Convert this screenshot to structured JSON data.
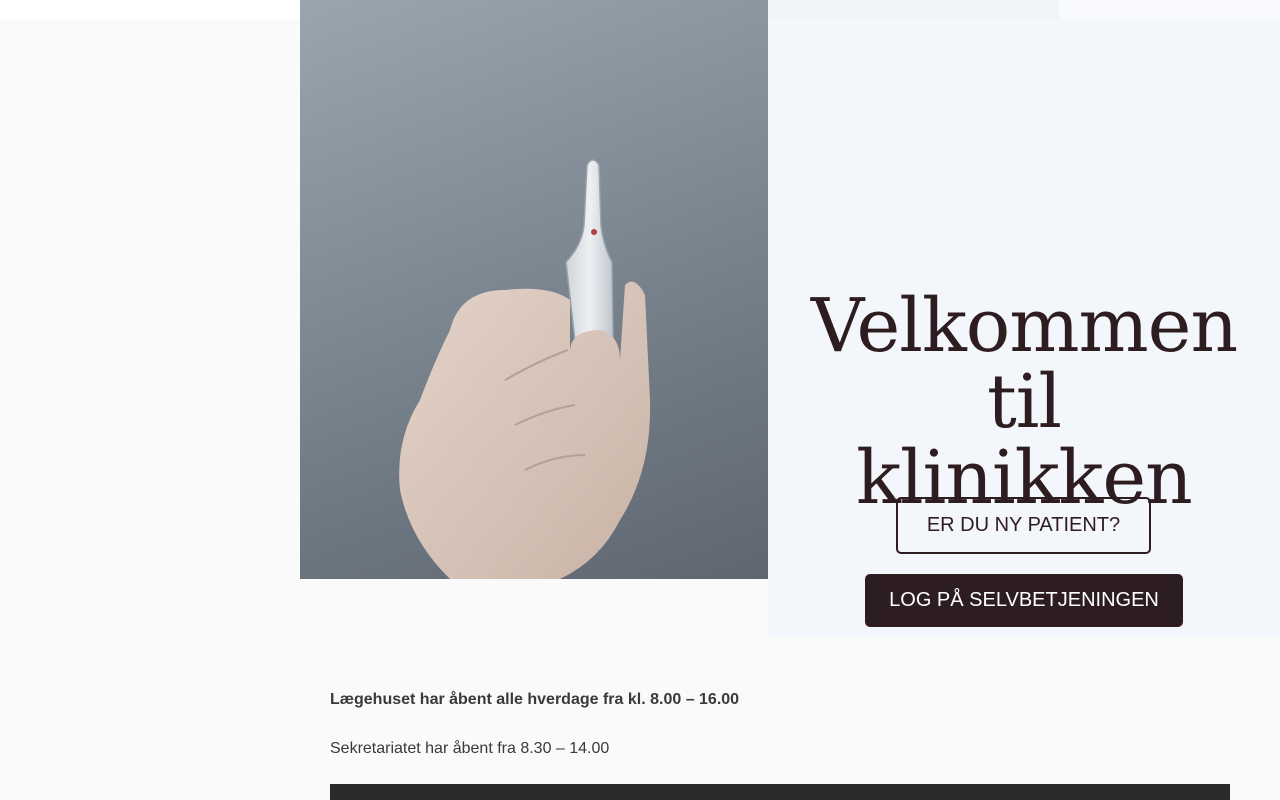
{
  "hero": {
    "title_line1": "Velkommen til",
    "title_line2": "klinikken",
    "new_patient_button": "ER DU NY PATIENT?",
    "login_button": "LOG PÅ SELVBETJENINGEN",
    "photo_subject": "hand-holding-ampoule"
  },
  "hours": {
    "opening": "Lægehuset har åbent alle hverdage fra kl. 8.00 – 16.00",
    "secretariat": "Sekretariatet har åbent fra 8.30 – 14.00"
  },
  "colors": {
    "brand_dark": "#2e1d20",
    "panel_bg": "#f3f6fa",
    "page_bg": "#fafafa",
    "text": "#3a3a3a",
    "footer_bar": "#2b2b2b"
  }
}
